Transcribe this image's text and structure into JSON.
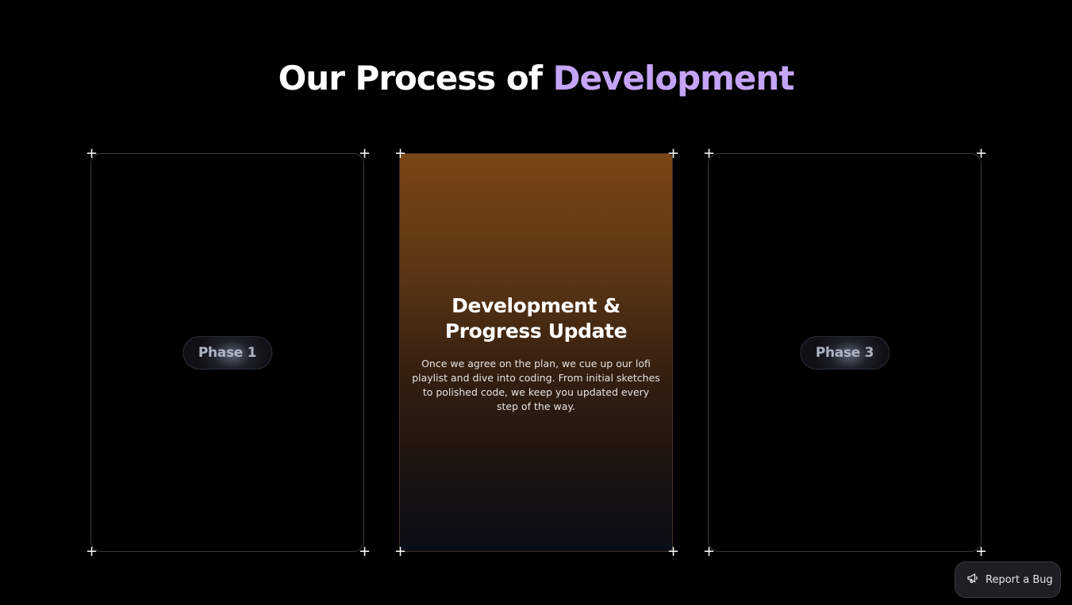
{
  "heading": {
    "prefix": "Our Process of ",
    "accent": "Development"
  },
  "cards": [
    {
      "pill": "Phase 1"
    },
    {
      "title_line1": "Development &",
      "title_line2": "Progress Update",
      "description": "Once we agree on the plan, we cue up our lofi playlist and dive into coding. From initial sketches to polished code, we keep you updated every step of the way."
    },
    {
      "pill": "Phase 3"
    }
  ],
  "bug_button": {
    "label": "Report a Bug",
    "icon": "megaphone-icon"
  },
  "colors": {
    "accent": "#c4a4f7",
    "background": "#000000",
    "active_card_top": "#7a4616",
    "active_card_bottom": "#0a0d18"
  }
}
